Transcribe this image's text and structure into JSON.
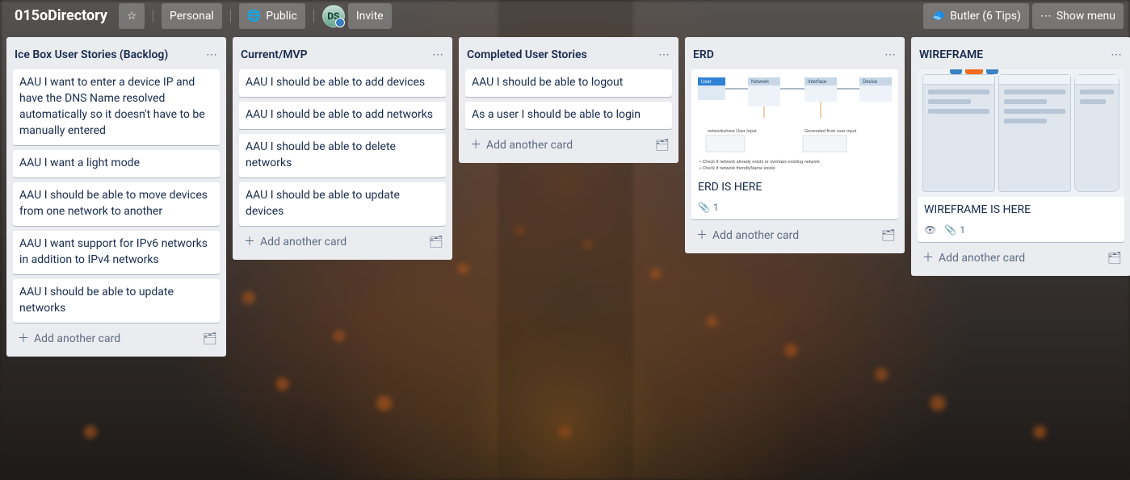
{
  "header": {
    "board_title": "015oDirectory",
    "star_icon": "star-icon",
    "visibility_personal": "Personal",
    "visibility_public": "Public",
    "avatar_initials": "DS",
    "invite": "Invite",
    "butler": "Butler (6 Tips)",
    "show_menu": "Show menu"
  },
  "lists": [
    {
      "title": "Ice Box User Stories (Backlog)",
      "add_label": "Add another card",
      "cards": [
        {
          "text": "AAU I want to enter a device IP and have the DNS Name resolved automatically so it doesn't have to be manually entered"
        },
        {
          "text": "AAU I want a light mode"
        },
        {
          "text": "AAU I should be able to move devices from one network to another"
        },
        {
          "text": "AAU I want support for IPv6 networks in addition to IPv4 networks"
        },
        {
          "text": "AAU I should be able to update networks"
        }
      ]
    },
    {
      "title": "Current/MVP",
      "add_label": "Add another card",
      "cards": [
        {
          "text": "AAU I should be able to add devices"
        },
        {
          "text": "AAU I should be able to add networks"
        },
        {
          "text": "AAU I should be able to delete networks"
        },
        {
          "text": "AAU I should be able to update devices"
        }
      ]
    },
    {
      "title": "Completed User Stories",
      "add_label": "Add another card",
      "cards": [
        {
          "text": "AAU I should be able to logout"
        },
        {
          "text": "As a user I should be able to login"
        }
      ]
    },
    {
      "title": "ERD",
      "add_label": "Add another card",
      "cards": [
        {
          "text": "ERD IS HERE",
          "cover": "erd",
          "badges": {
            "attachments": "1"
          }
        }
      ]
    },
    {
      "title": "WIREFRAME",
      "add_label": "Add another card",
      "cards": [
        {
          "text": "WIREFRAME IS HERE",
          "cover": "wireframe",
          "badges": {
            "watching": true,
            "attachments": "1"
          }
        }
      ]
    }
  ],
  "erd": {
    "entities": [
      "User",
      "Network",
      "Interface",
      "Device"
    ],
    "note_lines": [
      "networks/new User Input",
      "Generated from user input",
      "• Check if network already exists or overlaps existing network",
      "• Check if network friendlyName exists"
    ]
  },
  "icons": {
    "globe": "🌐",
    "star": "☆",
    "butler": "🎩",
    "dots": "⋯",
    "plus": "+",
    "template": "⎘",
    "attach": "📎",
    "eye": "👁"
  }
}
